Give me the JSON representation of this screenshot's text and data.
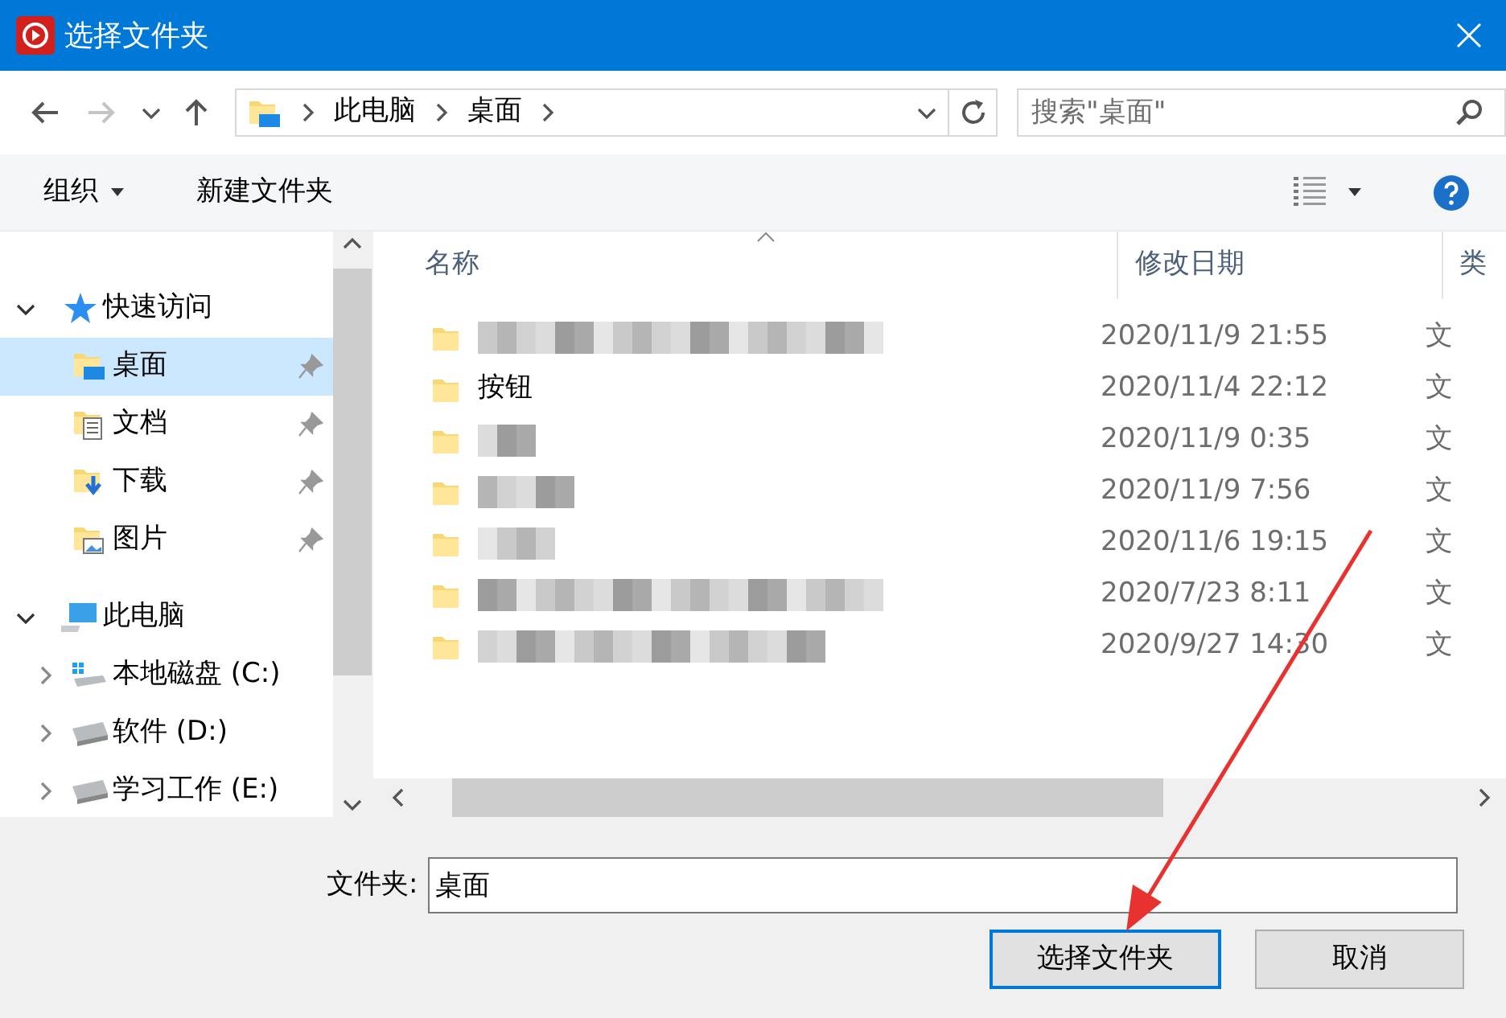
{
  "window": {
    "title": "选择文件夹"
  },
  "address": {
    "crumbs": [
      "此电脑",
      "桌面"
    ]
  },
  "search": {
    "placeholder": "搜索\"桌面\""
  },
  "toolbar": {
    "organize": "组织",
    "new_folder": "新建文件夹"
  },
  "sidebar": {
    "items": [
      {
        "label": "快速访问",
        "kind": "star",
        "expanded": true,
        "selected": false,
        "children": [
          {
            "label": "桌面",
            "kind": "desktop",
            "pinned": true,
            "selected": true
          },
          {
            "label": "文档",
            "kind": "documents",
            "pinned": true,
            "selected": false
          },
          {
            "label": "下载",
            "kind": "downloads",
            "pinned": true,
            "selected": false
          },
          {
            "label": "图片",
            "kind": "pictures",
            "pinned": true,
            "selected": false
          }
        ]
      },
      {
        "label": "此电脑",
        "kind": "pc",
        "expanded": true,
        "selected": false,
        "children": [
          {
            "label": "本地磁盘 (C:)",
            "kind": "system_drive",
            "expanded": false,
            "selected": false
          },
          {
            "label": "软件 (D:)",
            "kind": "drive",
            "expanded": false,
            "selected": false
          },
          {
            "label": "学习工作 (E:)",
            "kind": "drive",
            "expanded": false,
            "selected": false
          }
        ]
      }
    ]
  },
  "table": {
    "columns": [
      "名称",
      "修改日期",
      "类"
    ],
    "rows": [
      {
        "redacted": true,
        "modified": "2020/11/9 21:55",
        "type": "文"
      },
      {
        "name": "按钮",
        "redacted": false,
        "modified": "2020/11/4 22:12",
        "type": "文"
      },
      {
        "redacted": true,
        "modified": "2020/11/9 0:35",
        "type": "文"
      },
      {
        "redacted": true,
        "modified": "2020/11/9 7:56",
        "type": "文"
      },
      {
        "redacted": true,
        "modified": "2020/11/6 19:15",
        "type": "文"
      },
      {
        "redacted": true,
        "modified": "2020/7/23 8:11",
        "type": "文"
      },
      {
        "redacted": true,
        "modified": "2020/9/27 14:30",
        "type": "文"
      }
    ]
  },
  "folder_field": {
    "label": "文件夹:",
    "value": "桌面"
  },
  "buttons": [
    {
      "label": "选择文件夹",
      "kind": "primary"
    },
    {
      "label": "取消",
      "kind": "secondary"
    }
  ],
  "overlay": {
    "kind": "arrow",
    "color": "#e8322f"
  }
}
